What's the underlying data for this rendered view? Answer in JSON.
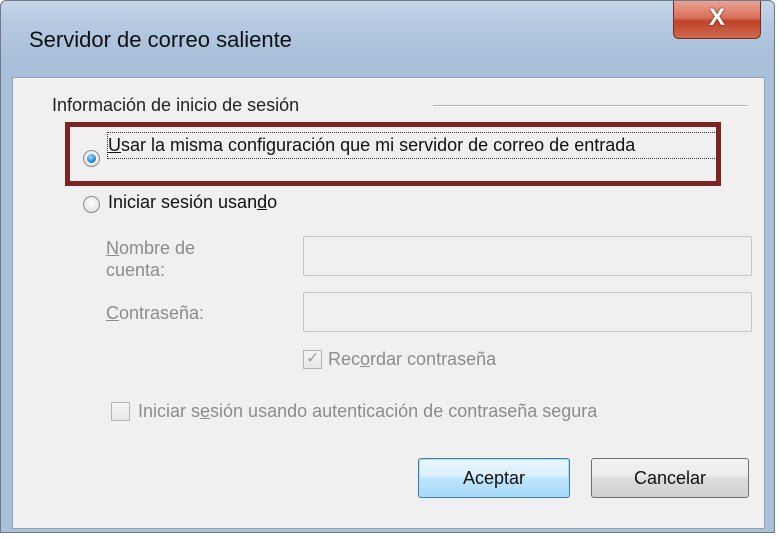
{
  "window": {
    "title": "Servidor de correo saliente",
    "close_glyph": "X"
  },
  "group": {
    "label": "Información de inicio de sesión"
  },
  "options": {
    "same_config": "Usar la misma configuración que mi servidor de correo de entrada",
    "login_prefix": "Iniciar sesión usan",
    "login_accel": "d",
    "login_suffix": "o"
  },
  "fields": {
    "account_accel": "N",
    "account_rest": "ombre de cuenta:",
    "password_accel": "C",
    "password_rest": "ontraseña:",
    "account_value": "",
    "password_value": ""
  },
  "checkboxes": {
    "remember_prefix": "Rec",
    "remember_accel": "o",
    "remember_suffix": "rdar contraseña",
    "remember_checked": true,
    "secure_prefix": "Iniciar s",
    "secure_accel": "e",
    "secure_suffix": "sión usando autenticación de contraseña segura",
    "secure_checked": false
  },
  "buttons": {
    "ok": "Aceptar",
    "cancel": "Cancelar"
  },
  "colors": {
    "highlight": "#7a2424",
    "accent": "#2a8fd6"
  }
}
